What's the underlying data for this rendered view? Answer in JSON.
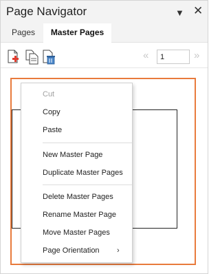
{
  "window": {
    "title": "Page Navigator",
    "dropdown_glyph": "▼",
    "close_glyph": "✕"
  },
  "tabs": [
    {
      "label": "Pages"
    },
    {
      "label": "Master Pages"
    }
  ],
  "toolbar": {
    "icons": [
      "add-page-icon",
      "duplicate-page-icon",
      "delete-page-icon"
    ],
    "prev_glyph": "«",
    "next_glyph": "»",
    "page_number": "1"
  },
  "colors": {
    "selection_border": "#e87a3c"
  },
  "context_menu": {
    "items": [
      {
        "label": "Cut"
      },
      {
        "label": "Copy"
      },
      {
        "label": "Paste"
      },
      {
        "label": "New Master Page"
      },
      {
        "label": "Duplicate Master Pages"
      },
      {
        "label": "Delete Master Pages"
      },
      {
        "label": "Rename Master Page"
      },
      {
        "label": "Move Master Pages"
      },
      {
        "label": "Page Orientation",
        "submenu_glyph": "›"
      }
    ]
  }
}
